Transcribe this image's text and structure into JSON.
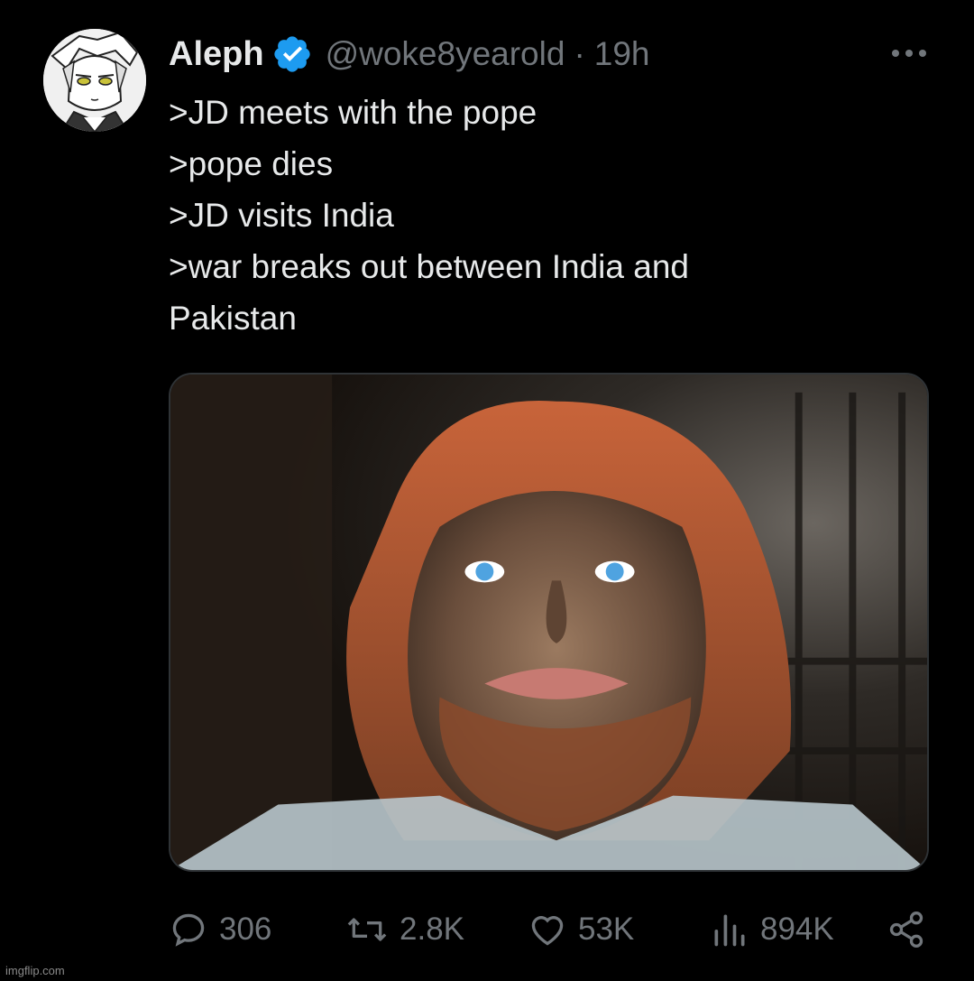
{
  "author": {
    "display_name": "Aleph",
    "handle": "@woke8yearold",
    "separator": "·",
    "time": "19h",
    "verified_icon": "verified-badge-icon",
    "avatar_icon": "anime-avatar"
  },
  "tweet": {
    "lines": [
      ">JD meets with the pope",
      ">pope dies",
      ">JD visits India",
      ">war breaks out between India and",
      "Pakistan"
    ],
    "media_description_icon": "photo"
  },
  "actions": {
    "reply_count": "306",
    "retweet_count": "2.8K",
    "like_count": "53K",
    "views_count": "894K"
  },
  "watermark": "imgflip.com",
  "colors": {
    "background": "#000000",
    "text_primary": "#e7e9ea",
    "text_secondary": "#71767b",
    "verified_blue": "#1d9bf0"
  }
}
